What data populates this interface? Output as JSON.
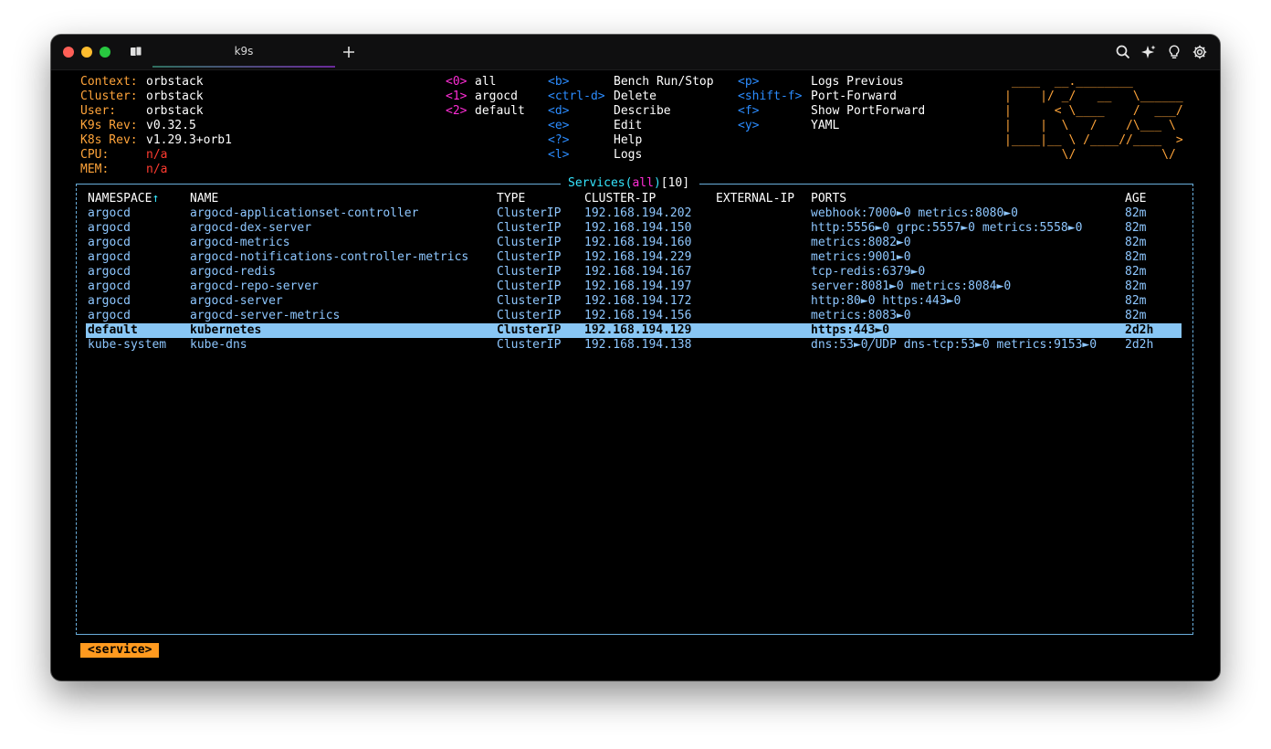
{
  "window": {
    "tab_title": "k9s"
  },
  "header": {
    "info": [
      {
        "label": "Context:",
        "value": "orbstack",
        "value_color": "white"
      },
      {
        "label": "Cluster:",
        "value": "orbstack",
        "value_color": "white"
      },
      {
        "label": "User:",
        "value": "orbstack",
        "value_color": "white"
      },
      {
        "label": "K9s Rev:",
        "value": "v0.32.5",
        "value_color": "white"
      },
      {
        "label": "K8s Rev:",
        "value": "v1.29.3+orb1",
        "value_color": "white"
      },
      {
        "label": "CPU:",
        "value": "n/a",
        "value_color": "red"
      },
      {
        "label": "MEM:",
        "value": "n/a",
        "value_color": "red"
      }
    ],
    "namespaces": [
      {
        "key": "<0>",
        "name": "all"
      },
      {
        "key": "<1>",
        "name": "argocd"
      },
      {
        "key": "<2>",
        "name": "default"
      }
    ],
    "shortcuts_a": [
      {
        "key": "<b>",
        "action": "Bench Run/Stop"
      },
      {
        "key": "<ctrl-d>",
        "action": "Delete"
      },
      {
        "key": "<d>",
        "action": "Describe"
      },
      {
        "key": "<e>",
        "action": "Edit"
      },
      {
        "key": "<?>",
        "action": "Help"
      },
      {
        "key": "<l>",
        "action": "Logs"
      }
    ],
    "shortcuts_b": [
      {
        "key": "<p>",
        "action": "Logs Previous"
      },
      {
        "key": "<shift-f>",
        "action": "Port-Forward"
      },
      {
        "key": "<f>",
        "action": "Show PortForward"
      },
      {
        "key": "<y>",
        "action": "YAML"
      }
    ],
    "logo": " ____  __.________       \n|    |/ _/   __   \\______\n|      < \\____    /  ___/\n|    |  \\   /    /\\___ \\ \n|____|__ \\ /____//____  >\n        \\/            \\/ "
  },
  "table": {
    "title": "Services",
    "filter": "all",
    "count": "10",
    "columns": [
      "NAMESPACE↑",
      "NAME",
      "TYPE",
      "CLUSTER-IP",
      "EXTERNAL-IP",
      "PORTS",
      "AGE"
    ],
    "rows": [
      [
        "argocd",
        "argocd-applicationset-controller",
        "ClusterIP",
        "192.168.194.202",
        "",
        "webhook:7000►0 metrics:8080►0",
        "82m"
      ],
      [
        "argocd",
        "argocd-dex-server",
        "ClusterIP",
        "192.168.194.150",
        "",
        "http:5556►0 grpc:5557►0 metrics:5558►0",
        "82m"
      ],
      [
        "argocd",
        "argocd-metrics",
        "ClusterIP",
        "192.168.194.160",
        "",
        "metrics:8082►0",
        "82m"
      ],
      [
        "argocd",
        "argocd-notifications-controller-metrics",
        "ClusterIP",
        "192.168.194.229",
        "",
        "metrics:9001►0",
        "82m"
      ],
      [
        "argocd",
        "argocd-redis",
        "ClusterIP",
        "192.168.194.167",
        "",
        "tcp-redis:6379►0",
        "82m"
      ],
      [
        "argocd",
        "argocd-repo-server",
        "ClusterIP",
        "192.168.194.197",
        "",
        "server:8081►0 metrics:8084►0",
        "82m"
      ],
      [
        "argocd",
        "argocd-server",
        "ClusterIP",
        "192.168.194.172",
        "",
        "http:80►0 https:443►0",
        "82m"
      ],
      [
        "argocd",
        "argocd-server-metrics",
        "ClusterIP",
        "192.168.194.156",
        "",
        "metrics:8083►0",
        "82m"
      ],
      [
        "default",
        "kubernetes",
        "ClusterIP",
        "192.168.194.129",
        "",
        "https:443►0",
        "2d2h"
      ],
      [
        "kube-system",
        "kube-dns",
        "ClusterIP",
        "192.168.194.138",
        "",
        "dns:53►0╱UDP dns-tcp:53►0 metrics:9153►0",
        "2d2h"
      ]
    ],
    "selected_row": 8
  },
  "crumbs": [
    "<service>"
  ],
  "colors": {
    "label": "#ffa43a",
    "key": "#2b8cff",
    "namespace_key": "#ff2dd6",
    "row_text": "#8ec7ff",
    "selected_bg": "#88c6f4",
    "border": "#6aaedc",
    "title": "#35e6ff",
    "crumb_bg": "#ff9a1f"
  }
}
